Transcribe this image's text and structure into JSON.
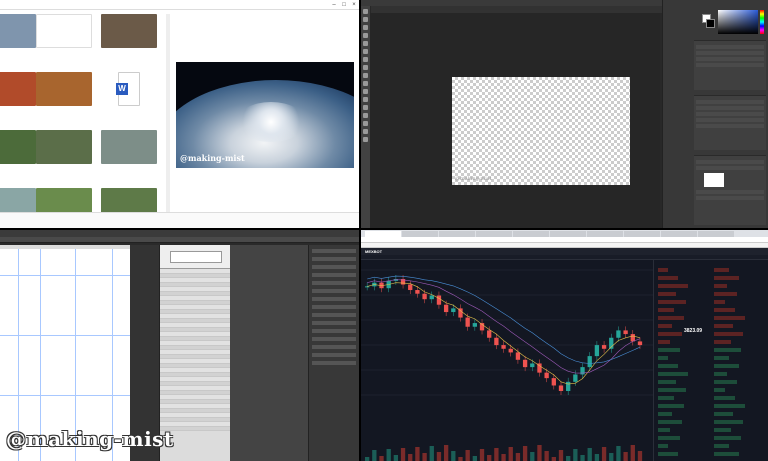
{
  "watermark": "@making-mist",
  "file_explorer": {
    "thumbnails": [
      {
        "caption": "",
        "color": "#7f95ad"
      },
      {
        "caption": "",
        "color": "#ffffff"
      },
      {
        "caption": "",
        "color": "#6b5a48"
      },
      {
        "caption": "",
        "color": "#b14b2a"
      },
      {
        "caption": "",
        "color": "#a8652e"
      },
      {
        "caption": "",
        "color": "#2a5bbf"
      },
      {
        "caption": "",
        "color": "#4c6b3a"
      },
      {
        "caption": "",
        "color": "#5b6e49"
      },
      {
        "caption": "",
        "color": "#7d8e88"
      },
      {
        "caption": "",
        "color": "#8aa6a5"
      },
      {
        "caption": "",
        "color": "#6a8c4c"
      },
      {
        "caption": "",
        "color": "#5e7a48"
      }
    ],
    "preview_watermark": "@making-mist"
  },
  "photoshop": {
    "canvas_watermark": "@making-mist"
  },
  "web_builder": {
    "topbar": [
      "",
      "",
      "",
      "",
      ""
    ],
    "panel_items": [
      "",
      "",
      "",
      "",
      "",
      "",
      "",
      "",
      "",
      ""
    ],
    "list_rows": 36,
    "listB_items": [
      "",
      "",
      "",
      "",
      "",
      ""
    ]
  },
  "trading": {
    "tabs": [
      "",
      "",
      "",
      "",
      "",
      "",
      "",
      "",
      "",
      ""
    ],
    "logo": "MEXBOT",
    "price": "3823.09",
    "chart_data": {
      "type": "line",
      "title": "",
      "xlabel": "",
      "ylabel": "",
      "description_free": true,
      "series": [
        {
          "values": [
            62,
            64,
            61,
            65,
            66,
            63,
            60,
            58,
            55,
            57,
            52,
            48,
            50,
            45,
            40,
            42,
            38,
            34,
            30,
            28,
            26,
            22,
            18,
            20,
            15,
            12,
            8,
            5,
            10,
            14,
            18,
            24,
            30,
            28,
            34,
            38,
            36,
            32,
            30
          ]
        }
      ]
    },
    "colors": {
      "up": "#26a69a",
      "down": "#ef5350",
      "bg": "#131722"
    }
  }
}
